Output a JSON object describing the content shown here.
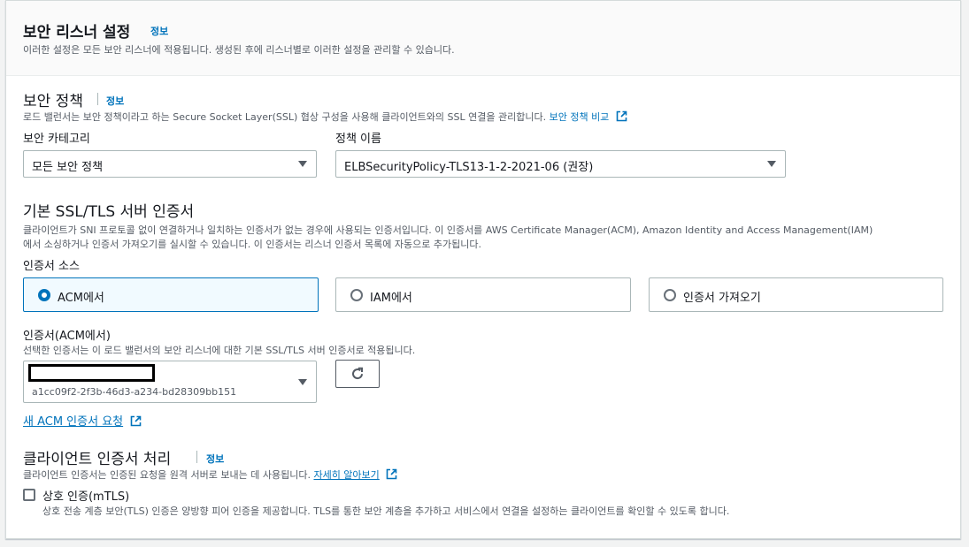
{
  "header": {
    "title": "보안 리스너 설정",
    "info": "정보",
    "description": "이러한 설정은 모든 보안 리스너에 적용됩니다. 생성된 후에 리스너별로 이러한 설정을 관리할 수 있습니다."
  },
  "policy": {
    "title": "보안 정책",
    "info": "정보",
    "description": "로드 밸런서는 보안 정책이라고 하는 Secure Socket Layer(SSL) 협상 구성을 사용해 클라이언트와의 SSL 연결을 관리합니다.",
    "compare_link": "보안 정책 비교",
    "category_label": "보안 카테고리",
    "category_value": "모든 보안 정책",
    "name_label": "정책 이름",
    "name_value": "ELBSecurityPolicy-TLS13-1-2-2021-06 (권장)"
  },
  "certificate": {
    "title": "기본 SSL/TLS 서버 인증서",
    "description_line1": "클라이언트가 SNI 프로토콜 없이 연결하거나 일치하는 인증서가 없는 경우에 사용되는 인증서입니다. 이 인증서를 AWS Certificate Manager(ACM), Amazon Identity and Access Management(IAM)",
    "description_line2": "에서 소싱하거나 인증서 가져오기를 실시할 수 있습니다. 이 인증서는 리스너 인증서 목록에 자동으로 추가됩니다.",
    "source_label": "인증서 소스",
    "sources": [
      "ACM에서",
      "IAM에서",
      "인증서 가져오기"
    ],
    "selected_source": 0,
    "acm_label": "인증서(ACM에서)",
    "acm_description": "선택한 인증서는 이 로드 밸런서의 보안 리스너에 대한 기본 SSL/TLS 서버 인증서로 적용됩니다.",
    "cert_id": "a1cc09f2-2f3b-46d3-a234-bd28309bb151",
    "request_link": "새 ACM 인증서 요청"
  },
  "client_cert": {
    "title": "클라이언트 인증서 처리",
    "info": "정보",
    "description": "클라이언트 인증서는 인증된 요청을 원격 서버로 보내는 데 사용됩니다.",
    "learn_more": "자세히 알아보기",
    "mtls_label": "상호 인증(mTLS)",
    "mtls_checked": false,
    "mtls_description": "상호 전송 계층 보안(TLS) 인증은 양방향 피어 인증을 제공합니다. TLS를 통한 보안 계층을 추가하고 서비스에서 연결을 설정하는 클라이언트를 확인할 수 있도록 합니다."
  },
  "colors": {
    "link": "#0073bb",
    "text": "#16191f",
    "muted": "#545b64",
    "selected_tile_bg": "#f1faff"
  }
}
